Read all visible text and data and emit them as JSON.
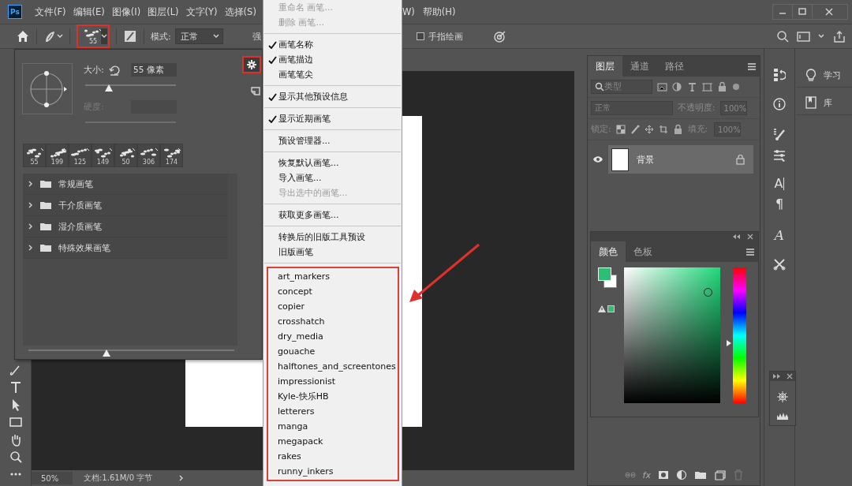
{
  "app_logo": "Ps",
  "menubar": {
    "items": [
      "文件(F)",
      "编辑(E)",
      "图像(I)",
      "图层(L)",
      "文字(Y)",
      "选择(S)"
    ],
    "items_after_menu": [
      "W)",
      "帮助(H)"
    ]
  },
  "options_bar": {
    "brush_size": "55",
    "mode_label": "模式:",
    "mode_value": "正常",
    "strength_label": "强",
    "finger_painting": {
      "label": "手指绘画",
      "checked": false
    }
  },
  "brush_panel": {
    "size_label": "大小:",
    "size_value": "55 像素",
    "size_slider": {
      "level": 0.26
    },
    "hardness_label": "硬度:",
    "hardness_disabled": true,
    "recent_brushes": [
      "55",
      "199",
      "125",
      "149",
      "50",
      "306",
      "174"
    ],
    "groups": [
      {
        "name": "常规画笔",
        "expanded": false
      },
      {
        "name": "干介质画笔",
        "expanded": false
      },
      {
        "name": "湿介质画笔",
        "expanded": false
      },
      {
        "name": "特殊效果画笔",
        "expanded": false
      }
    ],
    "scale_slider": {
      "level": 0.38
    }
  },
  "brush_menu": {
    "sections": [
      [
        {
          "label": "重命名 画笔...",
          "checked": false,
          "disabled": true
        },
        {
          "label": "删除 画笔...",
          "checked": false,
          "disabled": true
        }
      ],
      [
        {
          "label": "画笔名称",
          "checked": true,
          "disabled": false
        },
        {
          "label": "画笔描边",
          "checked": true,
          "disabled": false
        },
        {
          "label": "画笔笔尖",
          "checked": false,
          "disabled": false
        }
      ],
      [
        {
          "label": "显示其他预设信息",
          "checked": true,
          "disabled": false
        }
      ],
      [
        {
          "label": "显示近期画笔",
          "checked": true,
          "disabled": false
        }
      ],
      [
        {
          "label": "预设管理器...",
          "checked": false,
          "disabled": false
        }
      ],
      [
        {
          "label": "恢复默认画笔...",
          "checked": false,
          "disabled": false
        },
        {
          "label": "导入画笔...",
          "checked": false,
          "disabled": false
        },
        {
          "label": "导出选中的画笔...",
          "checked": false,
          "disabled": true
        }
      ],
      [
        {
          "label": "获取更多画笔...",
          "checked": false,
          "disabled": false
        }
      ],
      [
        {
          "label": "转换后的旧版工具预设",
          "checked": false,
          "disabled": false
        },
        {
          "label": "旧版画笔",
          "checked": false,
          "disabled": false
        }
      ]
    ],
    "libraries": [
      "art_markers",
      "concept",
      "copier",
      "crosshatch",
      "dry_media",
      "gouache",
      "halftones_and_screentones",
      "impressionist",
      "Kyle-快乐HB",
      "letterers",
      "manga",
      "megapack",
      "rakes",
      "runny_inkers"
    ]
  },
  "status_bar": {
    "zoom": "50%",
    "doc_info": "文档:1.61M/0 字节"
  },
  "layers_panel": {
    "tabs": [
      {
        "label": "图层",
        "selected": true
      },
      {
        "label": "通道",
        "selected": false
      },
      {
        "label": "路径",
        "selected": false
      }
    ],
    "filter_kind": "类型",
    "blend_mode": "正常",
    "opacity_label": "不透明度:",
    "opacity_value": "100%",
    "lock_label": "锁定:",
    "fill_label": "填充:",
    "fill_value": "100%",
    "layers": [
      {
        "name": "背景",
        "visible": true,
        "locked": true,
        "selected": true
      }
    ],
    "footer_fx": "fx"
  },
  "color_panel": {
    "tabs": [
      {
        "label": "颜色",
        "selected": true
      },
      {
        "label": "色板",
        "selected": false
      }
    ]
  },
  "icon_dock": {
    "character_glyph": "A",
    "paragraph_glyph": "¶",
    "glyphs_glyph": "A"
  },
  "learn_dock": [
    {
      "label": "学习",
      "kind": "learn"
    },
    {
      "label": "库",
      "kind": "library"
    }
  ]
}
